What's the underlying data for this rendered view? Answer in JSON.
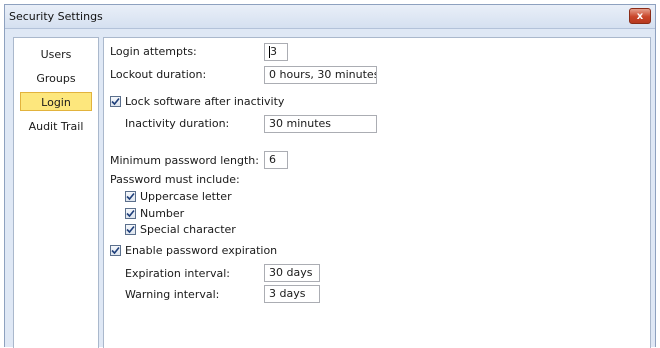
{
  "window": {
    "title": "Security Settings",
    "close_label": "x"
  },
  "sidebar": {
    "items": [
      {
        "label": "Users"
      },
      {
        "label": "Groups"
      },
      {
        "label": "Login",
        "active": true
      },
      {
        "label": "Audit Trail"
      }
    ]
  },
  "login": {
    "attempts_label": "Login attempts:",
    "attempts_value": "3",
    "lockout_label": "Lockout duration:",
    "lockout_value": "0 hours, 30 minutes",
    "lock_inactivity_label": "Lock software after inactivity",
    "lock_inactivity_checked": true,
    "inactivity_label": "Inactivity duration:",
    "inactivity_value": "30 minutes",
    "min_length_label": "Minimum password length:",
    "min_length_value": "6",
    "must_include_label": "Password must include:",
    "uppercase_label": "Uppercase letter",
    "uppercase_checked": true,
    "number_label": "Number",
    "number_checked": true,
    "special_label": "Special character",
    "special_checked": true,
    "expiration_label": "Enable password expiration",
    "expiration_checked": true,
    "expiration_interval_label": "Expiration interval:",
    "expiration_interval_value": "30 days",
    "warning_interval_label": "Warning interval:",
    "warning_interval_value": "3 days"
  },
  "colors": {
    "active_nav_bg": "#fde77d",
    "window_frame": "#dfe8f5",
    "close_button": "#c9452a"
  }
}
